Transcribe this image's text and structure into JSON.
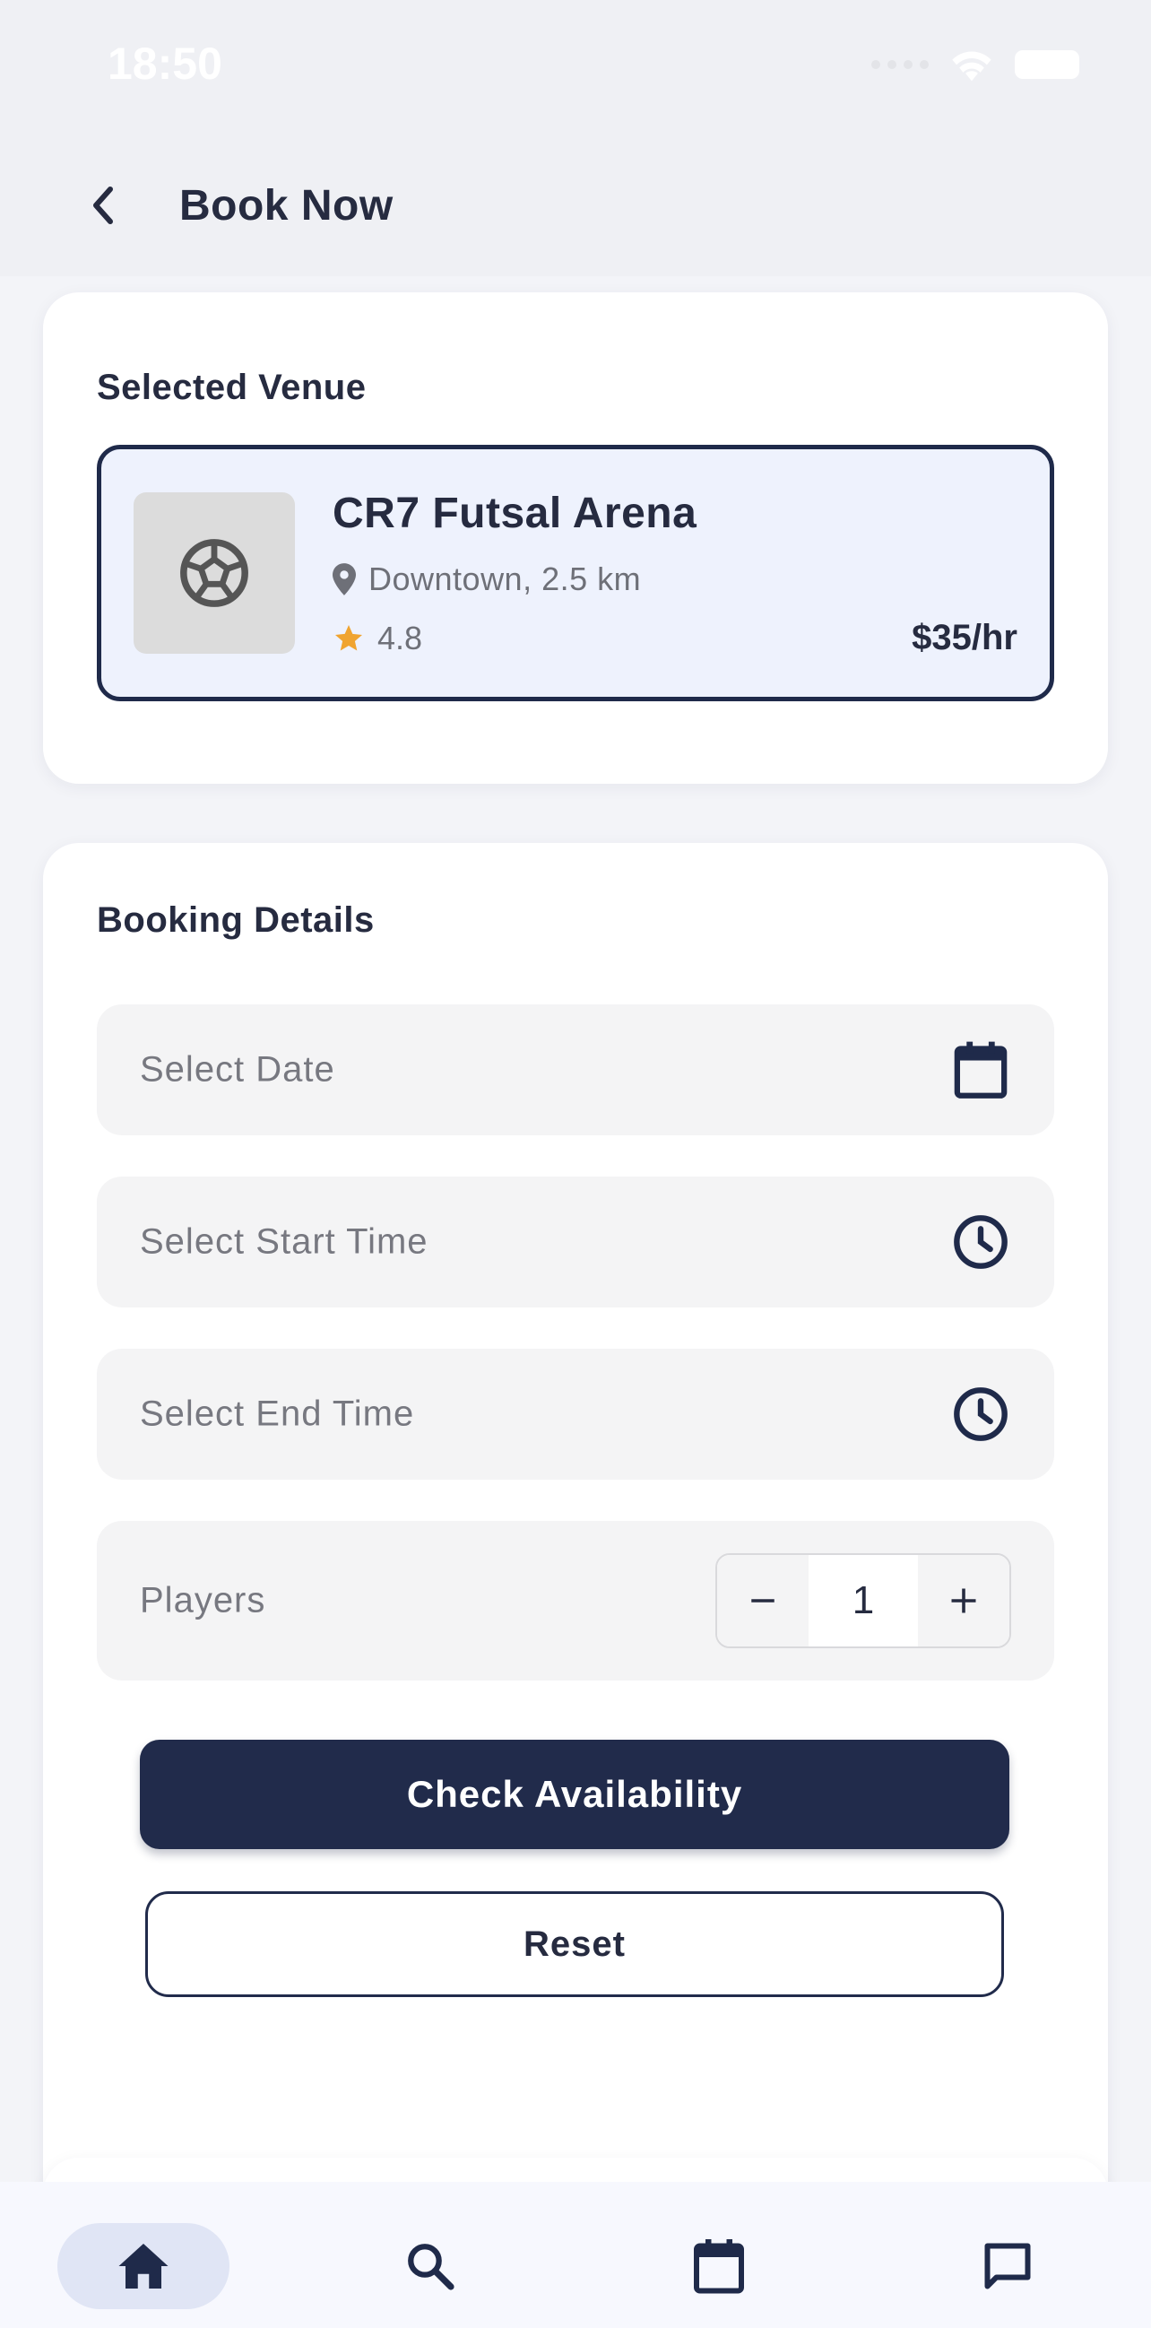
{
  "status_bar": {
    "time": "18:50"
  },
  "header": {
    "title": "Book Now",
    "back_icon": "chevron-left-icon"
  },
  "venue_section": {
    "title": "Selected Venue",
    "venue": {
      "name": "CR7 Futsal Arena",
      "location": "Downtown, 2.5 km",
      "rating": "4.8",
      "price": "$35/hr",
      "thumbnail_icon": "soccer-ball-icon"
    }
  },
  "booking_section": {
    "title": "Booking Details",
    "date_field": {
      "placeholder": "Select Date",
      "icon": "calendar-icon"
    },
    "start_time_field": {
      "placeholder": "Select Start Time",
      "icon": "clock-icon"
    },
    "end_time_field": {
      "placeholder": "Select End Time",
      "icon": "clock-icon"
    },
    "players": {
      "label": "Players",
      "value": "1",
      "decrement": "−",
      "increment": "+"
    },
    "check_availability_label": "Check Availability",
    "reset_label": "Reset"
  },
  "bottom_nav": {
    "items": [
      {
        "icon": "home-icon",
        "active": true
      },
      {
        "icon": "search-icon",
        "active": false
      },
      {
        "icon": "calendar-icon",
        "active": false
      },
      {
        "icon": "chat-icon",
        "active": false
      }
    ]
  },
  "colors": {
    "primary": "#212b4b",
    "background": "#f3f4f8",
    "card": "#ffffff",
    "field": "#f4f4f5",
    "venue_highlight": "#eef2fd",
    "star": "#f0a430",
    "nav_active": "#e0e5f5"
  }
}
